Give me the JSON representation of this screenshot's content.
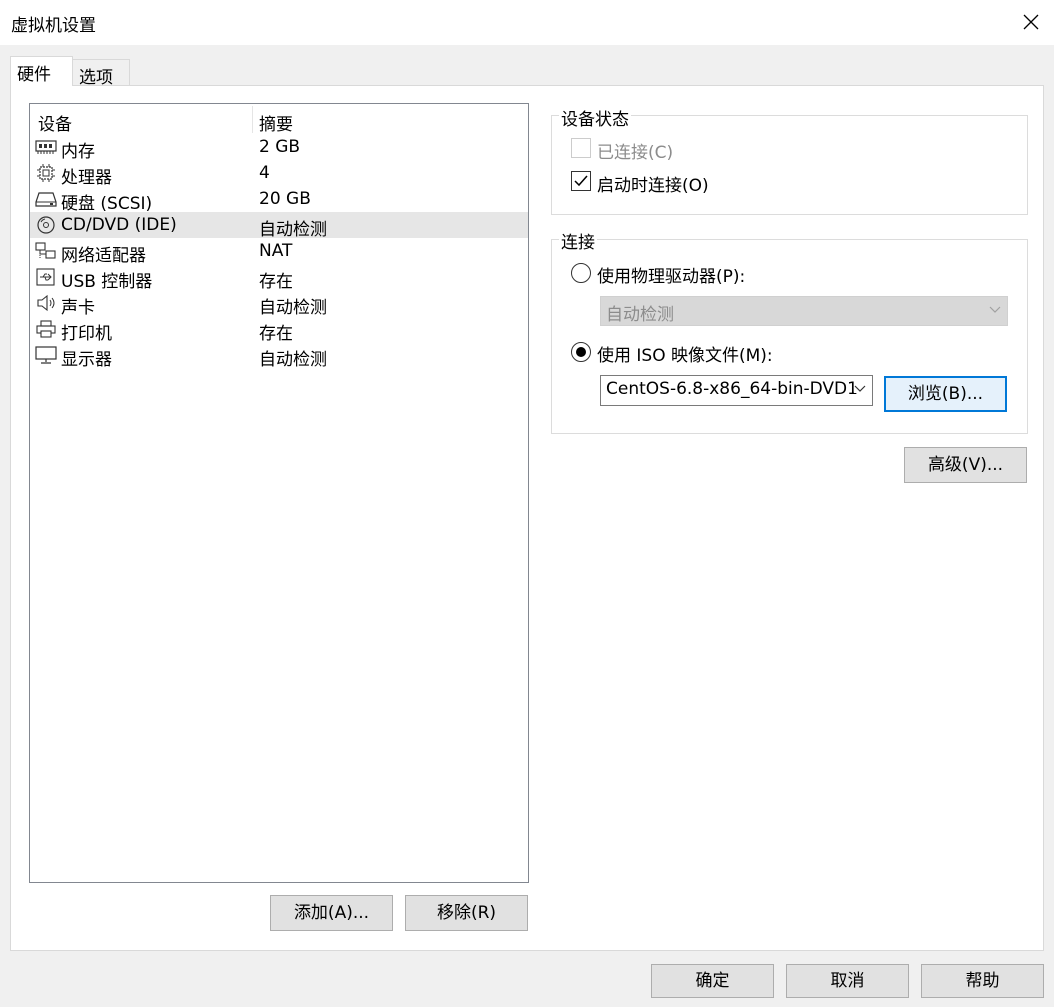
{
  "window": {
    "title": "虚拟机设置"
  },
  "tabs": [
    {
      "label": "硬件",
      "active": true
    },
    {
      "label": "选项",
      "active": false
    }
  ],
  "device_list": {
    "columns": [
      "设备",
      "摘要"
    ],
    "rows": [
      {
        "name": "内存",
        "summary": "2 GB",
        "icon": "memory-icon"
      },
      {
        "name": "处理器",
        "summary": "4",
        "icon": "cpu-icon"
      },
      {
        "name": "硬盘 (SCSI)",
        "summary": "20 GB",
        "icon": "hard-disk-icon"
      },
      {
        "name": "CD/DVD (IDE)",
        "summary": "自动检测",
        "icon": "cd-dvd-icon",
        "selected": true
      },
      {
        "name": "网络适配器",
        "summary": "NAT",
        "icon": "network-adapter-icon"
      },
      {
        "name": "USB 控制器",
        "summary": "存在",
        "icon": "usb-icon"
      },
      {
        "name": "声卡",
        "summary": "自动检测",
        "icon": "speaker-icon"
      },
      {
        "name": "打印机",
        "summary": "存在",
        "icon": "printer-icon"
      },
      {
        "name": "显示器",
        "summary": "自动检测",
        "icon": "monitor-icon"
      }
    ],
    "add_button": "添加(A)...",
    "remove_button": "移除(R)"
  },
  "device_status": {
    "title": "设备状态",
    "connected_label": "已连接(C)",
    "connected_checked": false,
    "connected_disabled": true,
    "connect_at_power_on_label": "启动时连接(O)",
    "connect_at_power_on_checked": true
  },
  "connection": {
    "title": "连接",
    "physical_drive_label": "使用物理驱动器(P):",
    "physical_drive_selected": false,
    "physical_drive_value": "自动检测",
    "iso_label": "使用 ISO 映像文件(M):",
    "iso_selected": true,
    "iso_value": "CentOS-6.8-x86_64-bin-DVD1",
    "browse_button": "浏览(B)..."
  },
  "advanced_button": "高级(V)...",
  "footer": {
    "ok": "确定",
    "cancel": "取消",
    "help": "帮助"
  }
}
